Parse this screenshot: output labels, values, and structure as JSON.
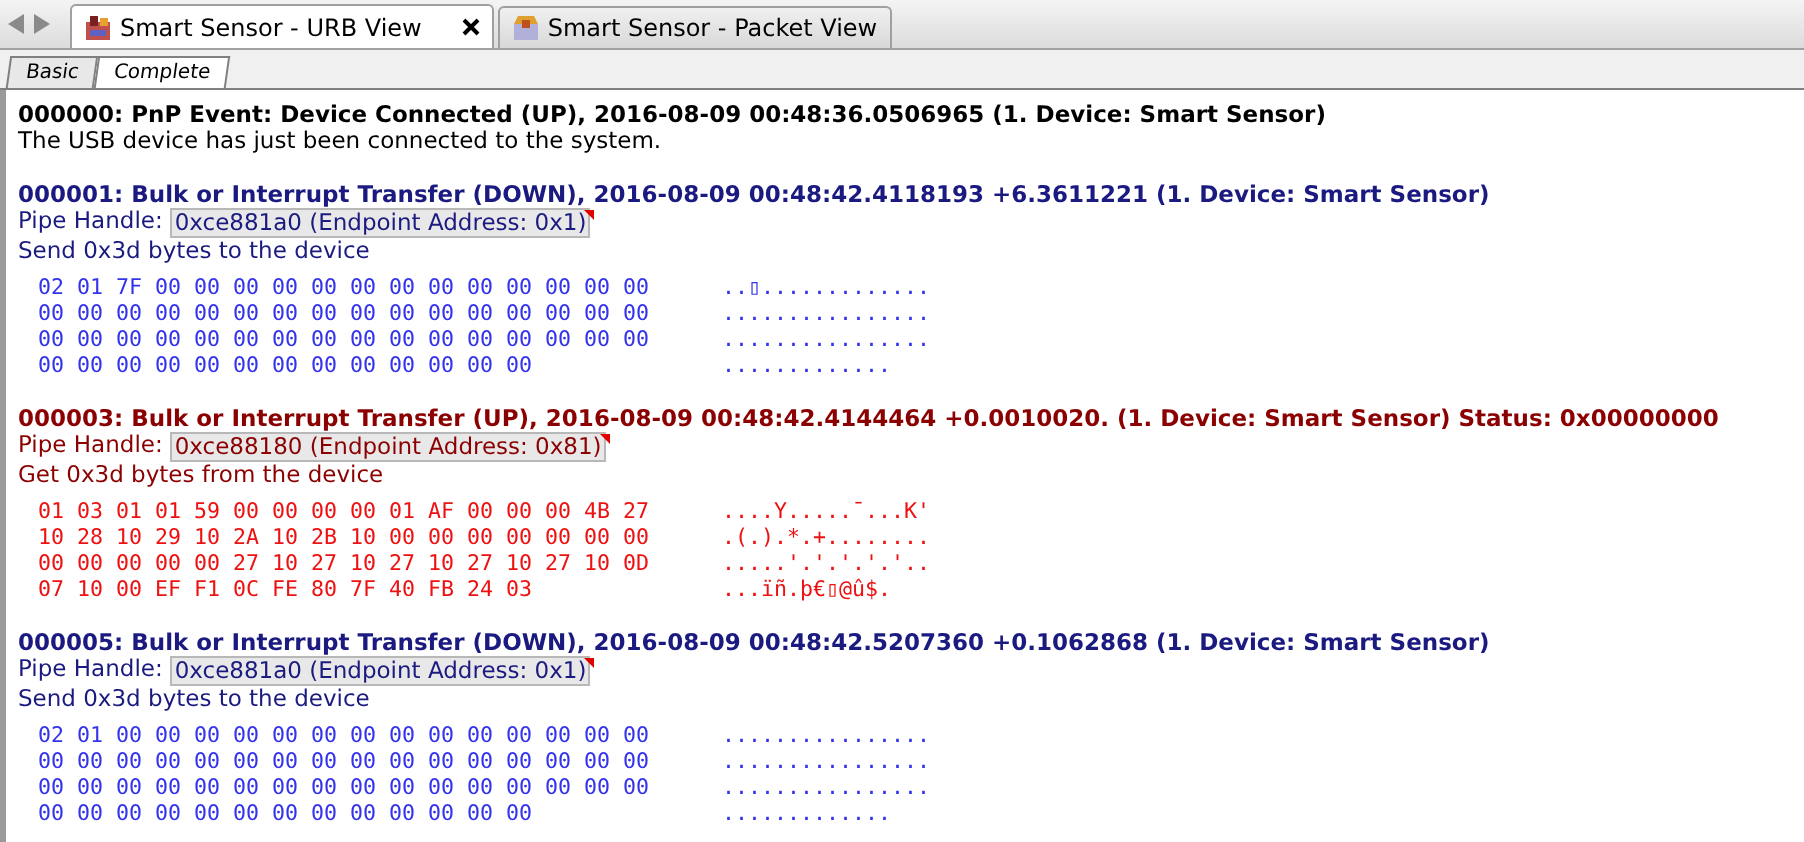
{
  "doc_tabs": [
    {
      "label": "Smart Sensor - URB View",
      "selected": true,
      "closable": true
    },
    {
      "label": "Smart Sensor - Packet View",
      "selected": false,
      "closable": false
    }
  ],
  "view_tabs": [
    {
      "label": "Basic",
      "selected": false
    },
    {
      "label": "Complete",
      "selected": true
    }
  ],
  "entries": [
    {
      "kind": "pnp",
      "header": "000000: PnP Event: Device Connected (UP), 2016-08-09 00:48:36.0506965 (1. Device: Smart Sensor)",
      "description": "The USB device has just been connected to the system."
    },
    {
      "kind": "down",
      "header": "000001: Bulk or Interrupt Transfer (DOWN), 2016-08-09 00:48:42.4118193 +6.3611221 (1. Device: Smart Sensor)",
      "pipe_label": "Pipe Handle:",
      "pipe_value": "0xce881a0 (Endpoint Address: 0x1)",
      "description": "Send 0x3d bytes to the device",
      "hex": [
        {
          "bytes": "02 01 7F 00 00 00 00 00 00 00 00 00 00 00 00 00",
          "ascii": "..▯............."
        },
        {
          "bytes": "00 00 00 00 00 00 00 00 00 00 00 00 00 00 00 00",
          "ascii": "................"
        },
        {
          "bytes": "00 00 00 00 00 00 00 00 00 00 00 00 00 00 00 00",
          "ascii": "................"
        },
        {
          "bytes": "00 00 00 00 00 00 00 00 00 00 00 00 00",
          "ascii": "............."
        }
      ]
    },
    {
      "kind": "up",
      "header": "000003: Bulk or Interrupt Transfer (UP), 2016-08-09 00:48:42.4144464 +0.0010020. (1. Device: Smart Sensor) Status: 0x00000000",
      "pipe_label": "Pipe Handle:",
      "pipe_value": "0xce88180 (Endpoint Address: 0x81)",
      "description": "Get 0x3d bytes from the device",
      "hex": [
        {
          "bytes": "01 03 01 01 59 00 00 00 00 01 AF 00 00 00 4B 27",
          "ascii": "....Y.....¯...K'"
        },
        {
          "bytes": "10 28 10 29 10 2A 10 2B 10 00 00 00 00 00 00 00",
          "ascii": ".(.).*.+........"
        },
        {
          "bytes": "00 00 00 00 00 27 10 27 10 27 10 27 10 27 10 0D",
          "ascii": ".....'.'.'.'.'.."
        },
        {
          "bytes": "07 10 00 EF F1 0C FE 80 7F 40 FB 24 03",
          "ascii": "...ïñ.þ€▯@û$."
        }
      ]
    },
    {
      "kind": "down",
      "header": "000005: Bulk or Interrupt Transfer (DOWN), 2016-08-09 00:48:42.5207360 +0.1062868 (1. Device: Smart Sensor)",
      "pipe_label": "Pipe Handle:",
      "pipe_value": "0xce881a0 (Endpoint Address: 0x1)",
      "description": "Send 0x3d bytes to the device",
      "hex": [
        {
          "bytes": "02 01 00 00 00 00 00 00 00 00 00 00 00 00 00 00",
          "ascii": "................"
        },
        {
          "bytes": "00 00 00 00 00 00 00 00 00 00 00 00 00 00 00 00",
          "ascii": "................"
        },
        {
          "bytes": "00 00 00 00 00 00 00 00 00 00 00 00 00 00 00 00",
          "ascii": "................"
        },
        {
          "bytes": "00 00 00 00 00 00 00 00 00 00 00 00 00",
          "ascii": "............."
        }
      ]
    }
  ]
}
